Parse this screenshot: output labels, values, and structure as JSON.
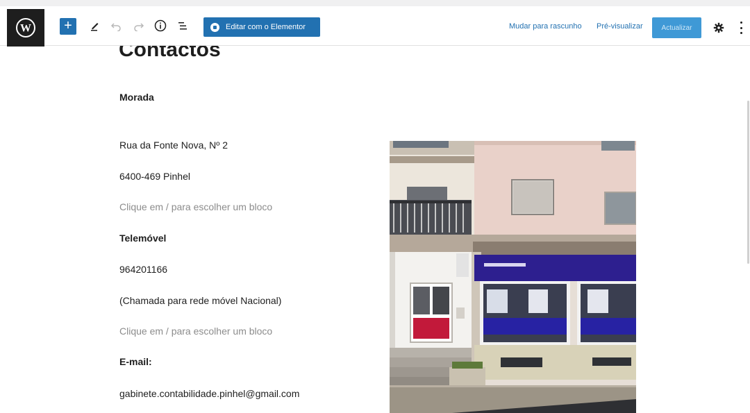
{
  "toolbar": {
    "add_block": "+",
    "elementor_label": "Editar com o Elementor",
    "save_draft": "Mudar para rascunho",
    "preview": "Pré-visualizar",
    "update": "Actualizar"
  },
  "page": {
    "title": "Contactos",
    "blocks": [
      {
        "text": "Morada",
        "style": "bold"
      },
      {
        "text": "Rua da Fonte Nova, Nº 2",
        "style": "normal"
      },
      {
        "text": "6400-469 Pinhel",
        "style": "normal"
      },
      {
        "text": "Clique em / para escolher um bloco",
        "style": "placeholder"
      },
      {
        "text": "Telemóvel",
        "style": "bold"
      },
      {
        "text": "964201166",
        "style": "normal"
      },
      {
        "text": "(Chamada para rede móvel Nacional)",
        "style": "normal"
      },
      {
        "text": "Clique em / para escolher um bloco",
        "style": "placeholder"
      },
      {
        "text": "E-mail:",
        "style": "bold"
      },
      {
        "text": "gabinete.contabilidade.pinhel@gmail.com",
        "style": "normal"
      }
    ]
  },
  "icons": {
    "logo": "wordpress-icon",
    "tools": [
      "pencil-icon",
      "undo-icon",
      "redo-icon",
      "info-icon",
      "list-view-icon",
      "gear-icon",
      "more-vertical-icon"
    ]
  },
  "colors": {
    "accent": "#2271b1",
    "update_button": "#3f99d6",
    "logo_bg": "#1e1e1e",
    "placeholder_text": "#8c8c8c",
    "storefront_blue": "#2d1f8f"
  }
}
